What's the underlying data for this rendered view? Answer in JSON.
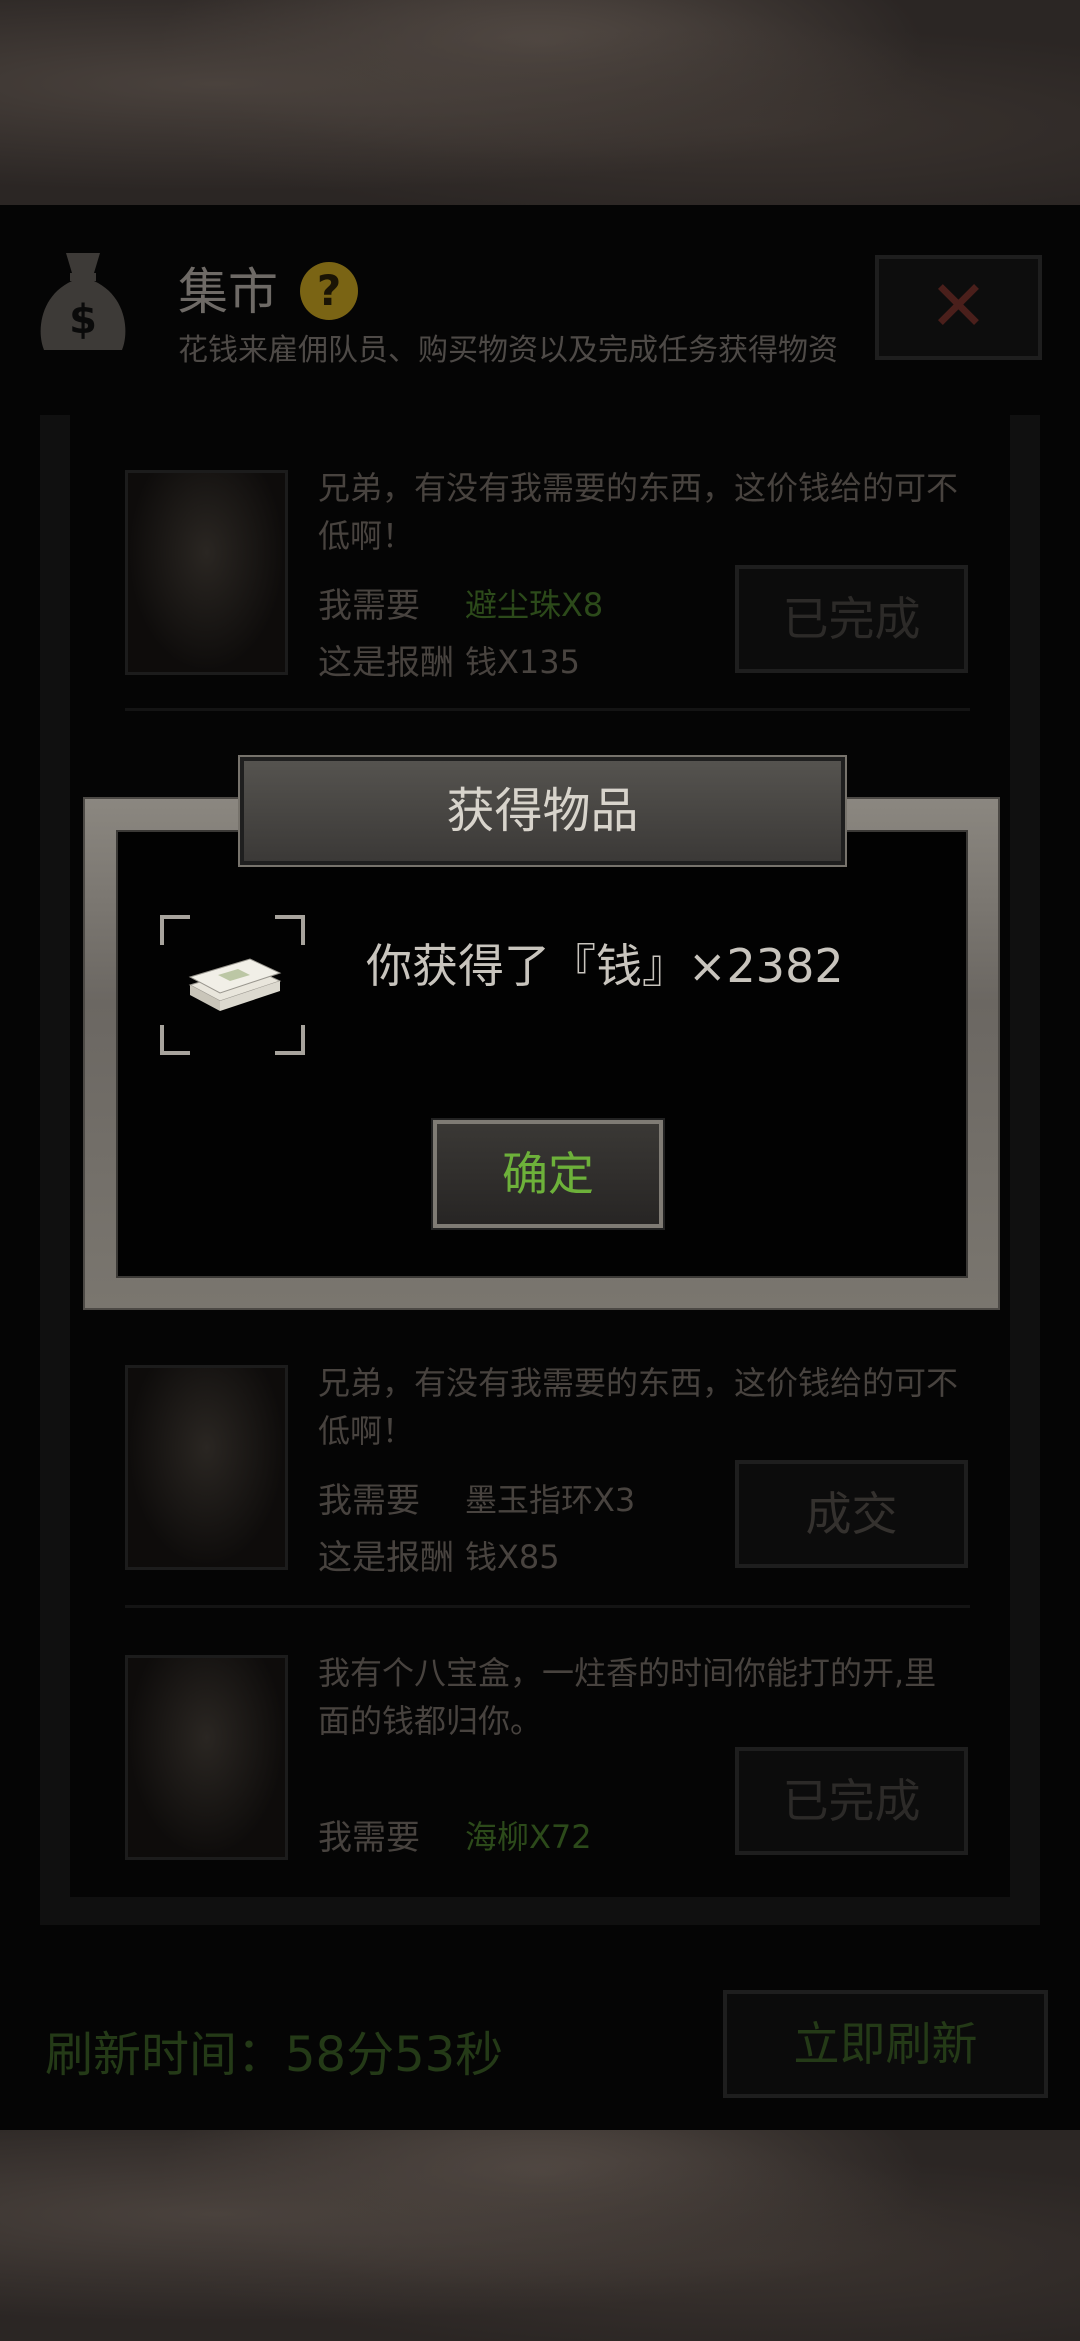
{
  "header": {
    "title": "集市",
    "help_icon": "?",
    "subtitle": "花钱来雇佣队员、购买物资以及完成任务获得物资",
    "close_icon": "✕"
  },
  "quests": [
    {
      "text": "兄弟，有没有我需要的东西，这价钱给的可不低啊！",
      "need_label": "我需要",
      "need_item": "避尘珠X8",
      "reward_label": "这是报酬",
      "reward_item": "钱X135",
      "button": "已完成",
      "need_color": "#2c4a1a"
    },
    {
      "text": "兄弟，有没有我需要的东西，这价钱给的可不低啊！",
      "need_label": "我需要",
      "need_item": "墨玉指环X3",
      "reward_label": "这是报酬",
      "reward_item": "钱X85",
      "button": "成交",
      "need_color": "#48433f"
    },
    {
      "text": "我有个八宝盒，一炷香的时间你能打的开,里面的钱都归你。",
      "need_label": "我需要",
      "need_item": "海柳X72",
      "button": "已完成",
      "need_color": "#2c4a1a"
    }
  ],
  "footer": {
    "refresh_time_label": "刷新时间：58分53秒",
    "refresh_button": "立即刷新"
  },
  "dialog": {
    "title": "获得物品",
    "message": "你获得了『钱』×2382",
    "confirm_button": "确定",
    "item_icon": "money-stack-icon"
  },
  "colors": {
    "confirm_green": "#6db13a",
    "dialog_frame": "#7a766f"
  }
}
